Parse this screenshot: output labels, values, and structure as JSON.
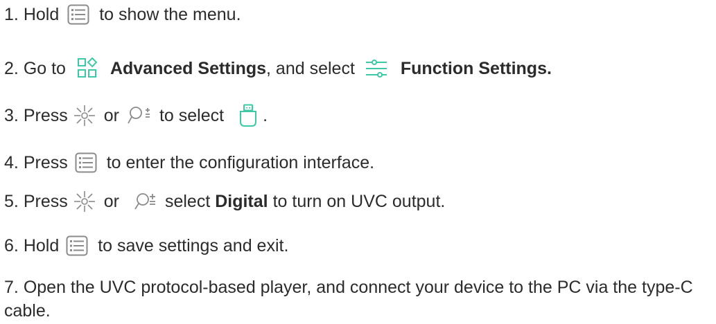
{
  "colors": {
    "text": "#2b2b2b",
    "accent": "#3cc9a6",
    "icon_gray": "#7a7a7a"
  },
  "steps": [
    {
      "num": "1.",
      "t1": "Hold",
      "t2": "to show the menu."
    },
    {
      "num": "2.",
      "t1": "Go to",
      "b1": "Advanced Settings",
      "t2": ", and select",
      "b2": "Function Settings."
    },
    {
      "num": "3.",
      "t1": "Press",
      "t2": "or",
      "t3": "to select",
      "t4": "."
    },
    {
      "num": "4.",
      "t1": "Press",
      "t2": "to enter the configuration interface."
    },
    {
      "num": "5.",
      "t1": "Press",
      "t2": "or",
      "t3": "select",
      "b1": "Digital",
      "t4": "to turn on UVC output."
    },
    {
      "num": "6.",
      "t1": "Hold",
      "t2": "to save settings and exit."
    },
    {
      "num": "7.",
      "text": "Open the UVC protocol-based player, and connect your device to the PC via the type-C cable."
    }
  ],
  "icons": {
    "menu": "menu-button-icon",
    "advanced": "advanced-settings-icon",
    "function": "function-settings-icon",
    "brightness": "brightness-button-icon",
    "zoom": "zoom-button-icon",
    "usb": "usb-output-icon"
  }
}
